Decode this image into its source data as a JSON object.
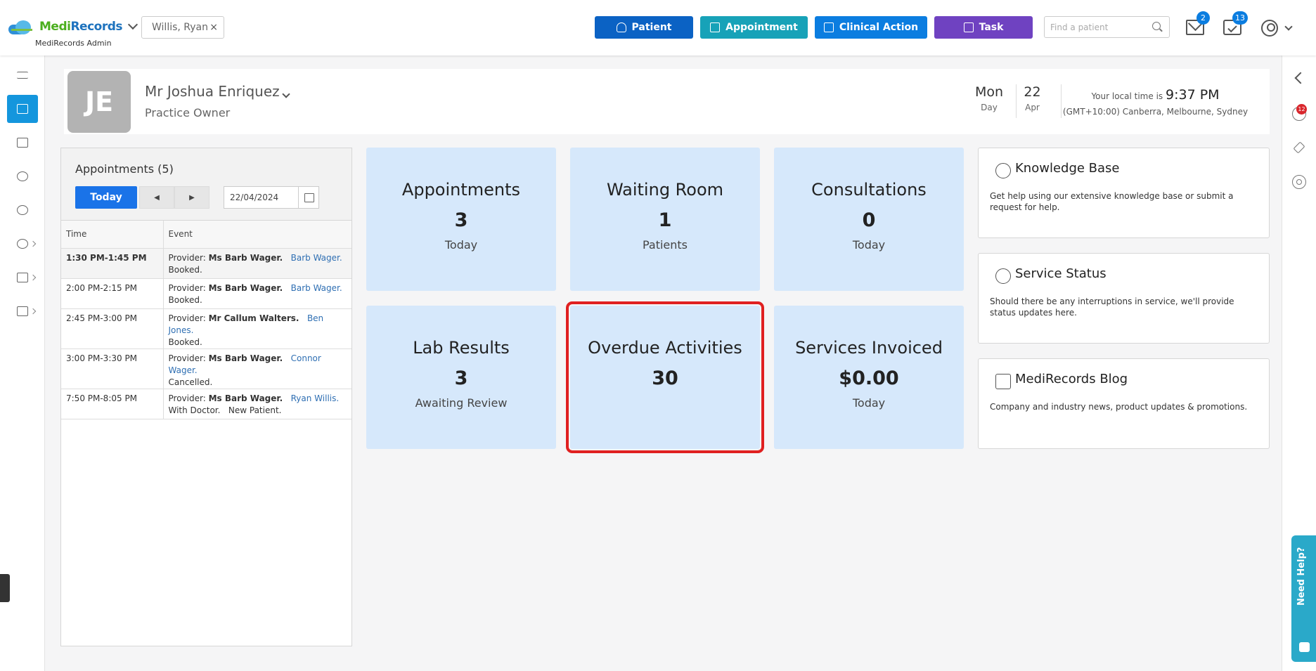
{
  "header": {
    "logo_part1": "Medi",
    "logo_part2": "Records",
    "logo_sub": "MediRecords Admin",
    "patient_chip": "Willis, Ryan",
    "patient_chip_close": "×",
    "buttons": {
      "patient": "Patient",
      "appointment": "Appointment",
      "clinical": "Clinical Action",
      "task": "Task"
    },
    "search_placeholder": "Find a patient",
    "mail_count": "2",
    "calendar_count": "13"
  },
  "profile": {
    "initials": "JE",
    "name": "Mr Joshua Enriquez",
    "role": "Practice Owner",
    "day": "Mon",
    "day_label": "Day",
    "date": "22",
    "month": "Apr",
    "local_time_label": "Your local time is",
    "local_time": "9:37 PM",
    "timezone": "(GMT+10:00) Canberra, Melbourne, Sydney"
  },
  "appointments": {
    "title": "Appointments (5)",
    "today_label": "Today",
    "prev_glyph": "◀",
    "next_glyph": "▶",
    "date_value": "22/04/2024",
    "columns": [
      "Time",
      "Event"
    ],
    "rows": [
      {
        "time": "1:30 PM-1:45 PM",
        "provider_label": "Provider:",
        "provider": "Ms Barb Wager.",
        "patient": "Barb Wager.",
        "status": "Booked.",
        "extra": ""
      },
      {
        "time": "2:00 PM-2:15 PM",
        "provider_label": "Provider:",
        "provider": "Ms Barb Wager.",
        "patient": "Barb Wager.",
        "status": "Booked.",
        "extra": ""
      },
      {
        "time": "2:45 PM-3:00 PM",
        "provider_label": "Provider:",
        "provider": "Mr Callum Walters.",
        "patient": "Ben Jones.",
        "status": "Booked.",
        "extra": ""
      },
      {
        "time": "3:00 PM-3:30 PM",
        "provider_label": "Provider:",
        "provider": "Ms Barb Wager.",
        "patient": "Connor Wager.",
        "status": "Cancelled.",
        "extra": ""
      },
      {
        "time": "7:50 PM-8:05 PM",
        "provider_label": "Provider:",
        "provider": "Ms Barb Wager.",
        "patient": "Ryan Willis.",
        "status": "With Doctor.",
        "extra": "New Patient."
      }
    ]
  },
  "cards": [
    {
      "title": "Appointments",
      "value": "3",
      "sub": "Today"
    },
    {
      "title": "Waiting Room",
      "value": "1",
      "sub": "Patients"
    },
    {
      "title": "Consultations",
      "value": "0",
      "sub": "Today"
    },
    {
      "title": "Lab Results",
      "value": "3",
      "sub": "Awaiting Review"
    },
    {
      "title": "Overdue Activities",
      "value": "30",
      "sub": ""
    },
    {
      "title": "Services Invoiced",
      "value": "$0.00",
      "sub": "Today"
    }
  ],
  "info_panels": [
    {
      "title": "Knowledge Base",
      "text": "Get help using our extensive knowledge base or submit a request for help."
    },
    {
      "title": "Service Status",
      "text": "Should there be any interruptions in service, we'll provide status updates here."
    },
    {
      "title": "MediRecords Blog",
      "text": "Company and industry news, product updates & promotions."
    }
  ],
  "right_sidebar": {
    "chat_count": "12",
    "need_help": "Need Help?"
  },
  "colors": {
    "accent": "#1496dd",
    "patient_btn": "#0b62c4",
    "appointment_btn": "#17a2b8",
    "clinical_btn": "#0b7de0",
    "task_btn": "#6f42c1",
    "card_bg": "#d6e8fb",
    "highlight": "#e02020"
  }
}
